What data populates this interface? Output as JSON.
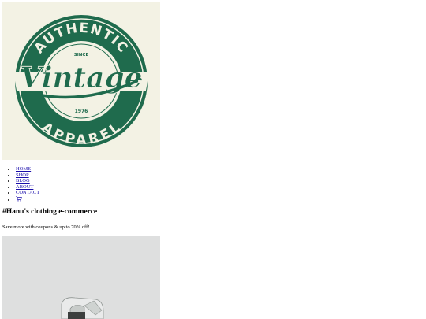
{
  "logo": {
    "top_text": "AUTHENTIC",
    "since": "SINCE",
    "script_text": "Vintage",
    "year": "1976",
    "bottom_text": "APPAREL",
    "colors": {
      "green": "#1f6b4d",
      "cream": "#f3f2e4"
    }
  },
  "nav": {
    "items": [
      {
        "label": "HOME"
      },
      {
        "label": "SHOP"
      },
      {
        "label": "BLOG"
      },
      {
        "label": "ABOUT"
      },
      {
        "label": "CONTACT"
      }
    ],
    "cart_icon": "cart-icon"
  },
  "main": {
    "heading": "#Hanu's clothing e-commerce",
    "subtext": "Save more with coupons & up to 70% off!"
  },
  "colors": {
    "link": "#1a0dab"
  }
}
